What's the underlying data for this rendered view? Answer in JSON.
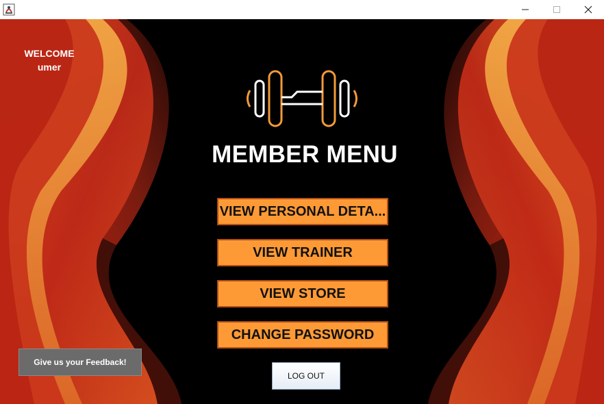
{
  "window": {
    "icon": "java-app-icon",
    "controls": [
      "minimize-icon",
      "maximize-icon",
      "close-icon"
    ]
  },
  "welcome": {
    "greeting": "WELCOME",
    "username": "umer"
  },
  "logo": {
    "icon": "dumbbell-icon"
  },
  "menu": {
    "title": "MEMBER MENU",
    "buttons": [
      {
        "label": "VIEW PERSONAL DETA..."
      },
      {
        "label": "VIEW TRAINER"
      },
      {
        "label": "VIEW STORE"
      },
      {
        "label": "CHANGE PASSWORD"
      }
    ],
    "logout_label": "LOG OUT"
  },
  "feedback": {
    "label": "Give us your Feedback!"
  },
  "colors": {
    "button_bg": "#fe9a35",
    "button_border": "#b34f16",
    "flame_orange": "#e8592a",
    "flame_red": "#b01e12",
    "flame_yellow": "#f7b14a",
    "background": "#000000"
  }
}
